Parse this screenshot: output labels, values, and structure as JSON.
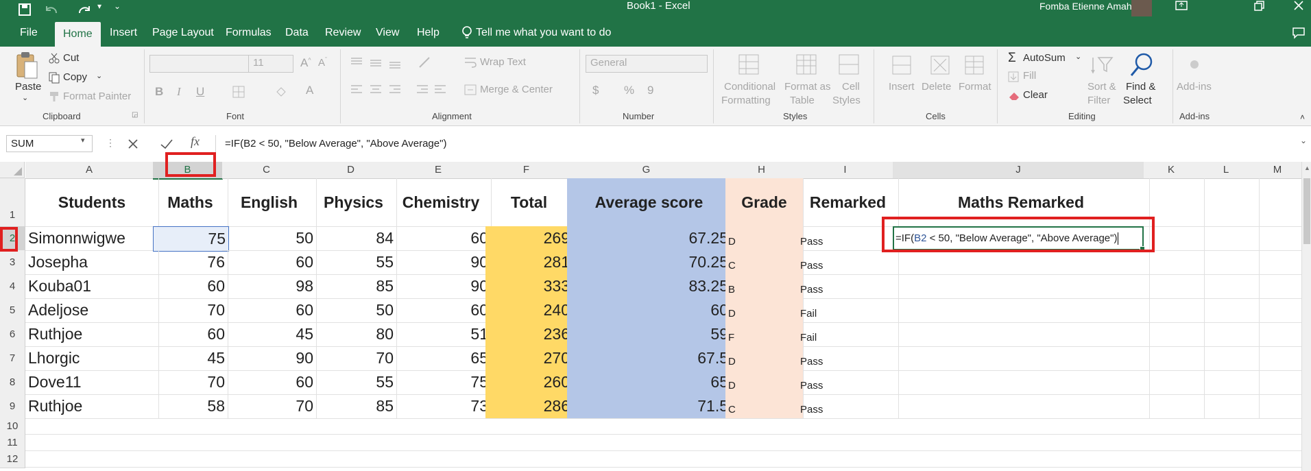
{
  "titlebar": {
    "title": "Book1  -  Excel",
    "user": "Fomba Etienne Amah"
  },
  "tabs": [
    "File",
    "Home",
    "Insert",
    "Page Layout",
    "Formulas",
    "Data",
    "Review",
    "View",
    "Help"
  ],
  "tell_me": "Tell me what you want to do",
  "ribbon": {
    "clipboard": {
      "paste": "Paste",
      "cut": "Cut",
      "copy": "Copy",
      "format_painter": "Format Painter",
      "group": "Clipboard"
    },
    "font": {
      "size": "11",
      "bold": "B",
      "italic": "I",
      "underline": "U",
      "group": "Font"
    },
    "alignment": {
      "wrap_text": "Wrap Text",
      "merge_center": "Merge & Center",
      "group": "Alignment"
    },
    "number": {
      "format": "General",
      "currency": "$",
      "percent": "%",
      "comma": "9",
      "group": "Number"
    },
    "styles": {
      "conditional_l1": "Conditional",
      "conditional_l2": "Formatting",
      "format_table_l1": "Format as",
      "format_table_l2": "Table",
      "cell_styles_l1": "Cell",
      "cell_styles_l2": "Styles",
      "group": "Styles"
    },
    "cells": {
      "insert": "Insert",
      "delete": "Delete",
      "format": "Format",
      "group": "Cells"
    },
    "editing": {
      "autosum": "AutoSum",
      "fill": "Fill",
      "clear": "Clear",
      "sort_l1": "Sort &",
      "sort_l2": "Filter",
      "find_l1": "Find &",
      "find_l2": "Select",
      "group": "Editing"
    },
    "addins": {
      "label": "Add-ins",
      "group": "Add-ins"
    }
  },
  "formula_bar": {
    "name_box": "SUM",
    "fx": "fx",
    "formula": "=IF(B2 < 50, \"Below Average\", \"Above Average\")"
  },
  "columns": [
    "A",
    "B",
    "C",
    "D",
    "E",
    "F",
    "G",
    "H",
    "I",
    "J",
    "K",
    "L",
    "M"
  ],
  "rows": [
    "1",
    "2",
    "3",
    "4",
    "5",
    "6",
    "7",
    "8",
    "9",
    "10",
    "11",
    "12"
  ],
  "headers": {
    "students": "Students",
    "maths": "Maths",
    "english": "English",
    "physics": "Physics",
    "chemistry": "Chemistry",
    "total": "Total",
    "average": "Average score",
    "grade": "Grade",
    "remarked": "Remarked",
    "maths_remarked": "Maths Remarked"
  },
  "data_rows": [
    {
      "name": "Simonnwigwe",
      "maths": "75",
      "english": "50",
      "physics": "84",
      "chemistry": "60",
      "total": "269",
      "average": "67.25",
      "grade": "D",
      "remark": "Pass"
    },
    {
      "name": "Josepha",
      "maths": "76",
      "english": "60",
      "physics": "55",
      "chemistry": "90",
      "total": "281",
      "average": "70.25",
      "grade": "C",
      "remark": "Pass"
    },
    {
      "name": "Kouba01",
      "maths": "60",
      "english": "98",
      "physics": "85",
      "chemistry": "90",
      "total": "333",
      "average": "83.25",
      "grade": "B",
      "remark": "Pass"
    },
    {
      "name": "Adeljose",
      "maths": "70",
      "english": "60",
      "physics": "50",
      "chemistry": "60",
      "total": "240",
      "average": "60",
      "grade": "D",
      "remark": "Fail"
    },
    {
      "name": "Ruthjoe",
      "maths": "60",
      "english": "45",
      "physics": "80",
      "chemistry": "51",
      "total": "236",
      "average": "59",
      "grade": "F",
      "remark": "Fail"
    },
    {
      "name": "Lhorgic",
      "maths": "45",
      "english": "90",
      "physics": "70",
      "chemistry": "65",
      "total": "270",
      "average": "67.5",
      "grade": "D",
      "remark": "Pass"
    },
    {
      "name": "Dove11",
      "maths": "70",
      "english": "60",
      "physics": "55",
      "chemistry": "75",
      "total": "260",
      "average": "65",
      "grade": "D",
      "remark": "Pass"
    },
    {
      "name": "Ruthjoe",
      "maths": "58",
      "english": "70",
      "physics": "85",
      "chemistry": "73",
      "total": "286",
      "average": "71.5",
      "grade": "C",
      "remark": "Pass"
    }
  ],
  "editing_cell": {
    "prefix": "=IF(",
    "ref": "B2",
    "suffix": " < 50, \"Below Average\", \"Above Average\")"
  },
  "colors": {
    "excel_green": "#217346",
    "total_fill": "#ffd966",
    "average_fill": "#b4c6e7",
    "grade_fill": "#fce4d6",
    "highlight_red": "#e02020",
    "ref_blue": "#2f5597"
  }
}
